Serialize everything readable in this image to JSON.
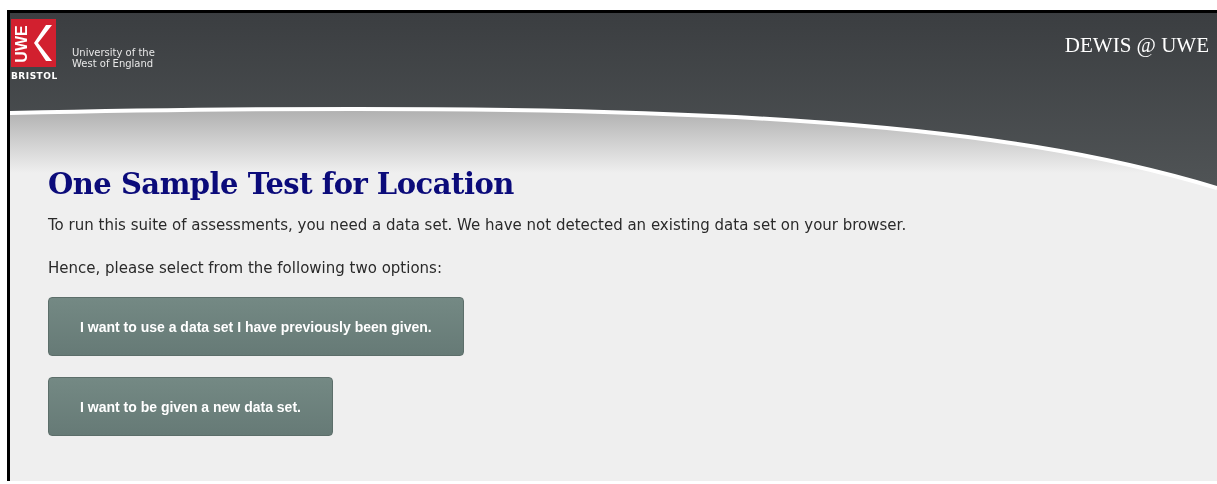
{
  "header": {
    "logo": {
      "mark": "UWE",
      "city": "BRISTOL",
      "name_lines": [
        "University of the",
        "West of England"
      ]
    },
    "site_title": "DEWIS @ UWE"
  },
  "content": {
    "title": "One Sample Test for Location",
    "paragraphs": [
      "To run this suite of assessments, you need a data set. We have not detected an existing data set on your browser.",
      "Hence, please select from the following two options:"
    ],
    "buttons": [
      "I want to use a data set I have previously been given.",
      "I want to be given a new data set."
    ]
  }
}
